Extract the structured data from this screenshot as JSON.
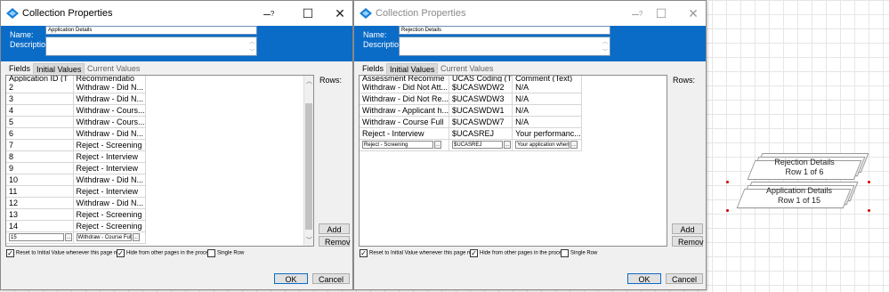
{
  "dialogs": [
    {
      "title": "Collection Properties",
      "name_label": "Name:",
      "name_value": "Application Details",
      "description_label": "Description:",
      "tabs": [
        "Fields",
        "Initial Values",
        "Current Values"
      ],
      "columns": [
        "Application ID (T",
        "Recommendatio"
      ],
      "rows": [
        [
          "2",
          "Withdraw - Did N..."
        ],
        [
          "3",
          "Withdraw - Did N..."
        ],
        [
          "4",
          "Withdraw - Cours..."
        ],
        [
          "5",
          "Withdraw - Cours..."
        ],
        [
          "6",
          "Withdraw - Did N..."
        ],
        [
          "7",
          "Reject - Screening"
        ],
        [
          "8",
          "Reject - Interview"
        ],
        [
          "9",
          "Reject - Interview"
        ],
        [
          "10",
          "Withdraw - Did N..."
        ],
        [
          "11",
          "Reject - Interview"
        ],
        [
          "12",
          "Withdraw - Did N..."
        ],
        [
          "13",
          "Reject - Screening"
        ],
        [
          "14",
          "Reject - Screening"
        ]
      ],
      "edit_row": [
        "15",
        "Withdraw - Course Full"
      ],
      "rows_label": "Rows:",
      "add_label": "Add",
      "remove_label": "Remov",
      "checkboxes": [
        {
          "label": "Reset to Initial Value whenever this page runs",
          "checked": true
        },
        {
          "label": "Hide from other pages in the process",
          "checked": true
        },
        {
          "label": "Single Row",
          "checked": false
        }
      ],
      "ok_label": "OK",
      "cancel_label": "Cancel"
    },
    {
      "title": "Collection Properties",
      "name_label": "Name:",
      "name_value": "Rejection Details",
      "description_label": "Description:",
      "tabs": [
        "Fields",
        "Initial Values",
        "Current Values"
      ],
      "columns": [
        "Assessment Recomme",
        "UCAS Coding (T",
        "Comment (Text)"
      ],
      "rows": [
        [
          "Withdraw - Did Not Att...",
          "$UCASWDW2",
          "N/A"
        ],
        [
          "Withdraw - Did Not Re...",
          "$UCASWDW3",
          "N/A"
        ],
        [
          "Withdraw - Applicant h...",
          "$UCASWDW1",
          "N/A"
        ],
        [
          "Withdraw - Course Full",
          "$UCASWDW7",
          "N/A"
        ],
        [
          "Reject - Interview",
          "$UCASREJ",
          "Your performanc..."
        ]
      ],
      "edit_row": [
        "Reject - Screening",
        "$UCASREJ",
        "Your application when co"
      ],
      "rows_label": "Rows:",
      "add_label": "Add",
      "remove_label": "Remov",
      "checkboxes": [
        {
          "label": "Reset to Initial Value whenever this page runs",
          "checked": true
        },
        {
          "label": "Hide from other pages in the process",
          "checked": true
        },
        {
          "label": "Single Row",
          "checked": false
        }
      ],
      "ok_label": "OK",
      "cancel_label": "Cancel"
    }
  ],
  "diagram": {
    "stages": [
      {
        "title": "Rejection Details",
        "subtitle": "Row 1 of 6"
      },
      {
        "title": "Application Details",
        "subtitle": "Row 1 of 15"
      }
    ]
  },
  "colors": {
    "accent": "#0a6cc7",
    "window_bg": "#f0f0f0",
    "handle": "#cc0000"
  },
  "icons": {
    "minimize": "minimize-icon",
    "maximize": "maximize-icon",
    "close": "close-icon",
    "help": "help-icon",
    "app": "blueprism-collection-icon"
  }
}
